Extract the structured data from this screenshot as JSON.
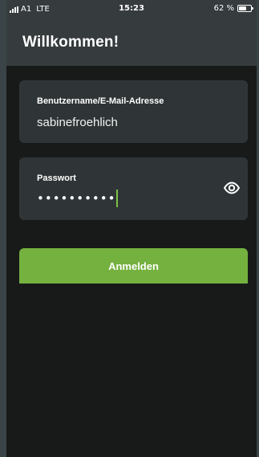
{
  "status_bar": {
    "carrier": "A1",
    "network": "LTE",
    "time": "15:23",
    "battery": "62 %",
    "battery_level": 0.62
  },
  "header": {
    "title": "Willkommen!"
  },
  "form": {
    "username_label": "Benutzername/E-Mail-Adresse",
    "username_value": "sabinefroehlich",
    "password_label": "Passwort",
    "password_masked": "••••••••••",
    "show_password_icon": "eye-icon"
  },
  "actions": {
    "login_label": "Anmelden"
  },
  "colors": {
    "accent": "#74b13e",
    "caret": "#7cc142",
    "background": "#181a1a",
    "surface": "#2f3536",
    "header": "#363b3d"
  }
}
